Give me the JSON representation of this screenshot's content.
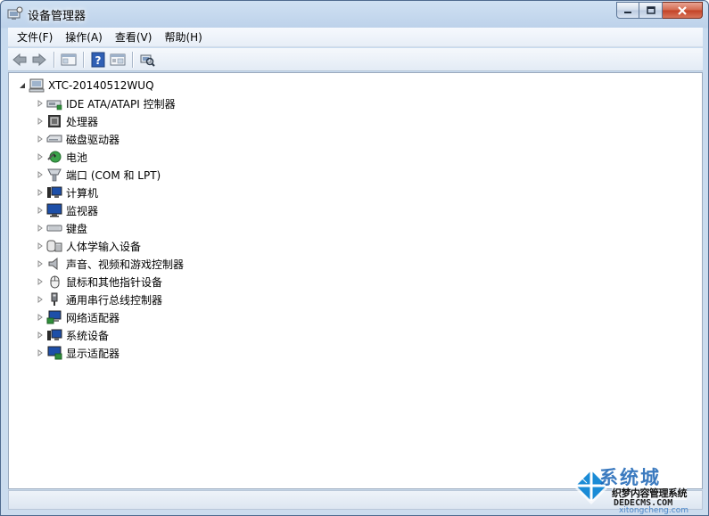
{
  "window": {
    "title": "设备管理器",
    "caption": {
      "minimize": "minimize",
      "maximize": "maximize",
      "close": "close"
    }
  },
  "menubar": {
    "items": [
      {
        "label": "文件(F)"
      },
      {
        "label": "操作(A)"
      },
      {
        "label": "查看(V)"
      },
      {
        "label": "帮助(H)"
      }
    ]
  },
  "toolbar": {
    "buttons": [
      {
        "icon": "back-arrow-icon"
      },
      {
        "icon": "forward-arrow-icon"
      },
      {
        "icon": "show-hide-console-tree-icon"
      },
      {
        "icon": "help-icon"
      },
      {
        "icon": "properties-icon"
      },
      {
        "icon": "scan-hardware-changes-icon"
      }
    ]
  },
  "tree": {
    "root": {
      "label": "XTC-20140512WUQ",
      "icon": "computer-icon",
      "expanded": true
    },
    "children": [
      {
        "label": "IDE ATA/ATAPI 控制器",
        "icon": "ide-controller-icon"
      },
      {
        "label": "处理器",
        "icon": "processor-icon"
      },
      {
        "label": "磁盘驱动器",
        "icon": "disk-drive-icon"
      },
      {
        "label": "电池",
        "icon": "battery-icon"
      },
      {
        "label": "端口 (COM 和 LPT)",
        "icon": "port-icon"
      },
      {
        "label": "计算机",
        "icon": "computer-icon"
      },
      {
        "label": "监视器",
        "icon": "monitor-icon"
      },
      {
        "label": "键盘",
        "icon": "keyboard-icon"
      },
      {
        "label": "人体学输入设备",
        "icon": "hid-icon"
      },
      {
        "label": "声音、视频和游戏控制器",
        "icon": "sound-icon"
      },
      {
        "label": "鼠标和其他指针设备",
        "icon": "mouse-icon"
      },
      {
        "label": "通用串行总线控制器",
        "icon": "usb-icon"
      },
      {
        "label": "网络适配器",
        "icon": "network-adapter-icon"
      },
      {
        "label": "系统设备",
        "icon": "system-device-icon"
      },
      {
        "label": "显示适配器",
        "icon": "display-adapter-icon"
      }
    ]
  },
  "watermark": {
    "brand_cn": "系统城",
    "line1": "织梦内容管理系统",
    "line2": "DEDECMS.COM",
    "line3": "xitongcheng.com"
  },
  "colors": {
    "title_bg": "#bdd2ea",
    "close_red": "#c34226",
    "brand_blue": "#1a63b5"
  }
}
